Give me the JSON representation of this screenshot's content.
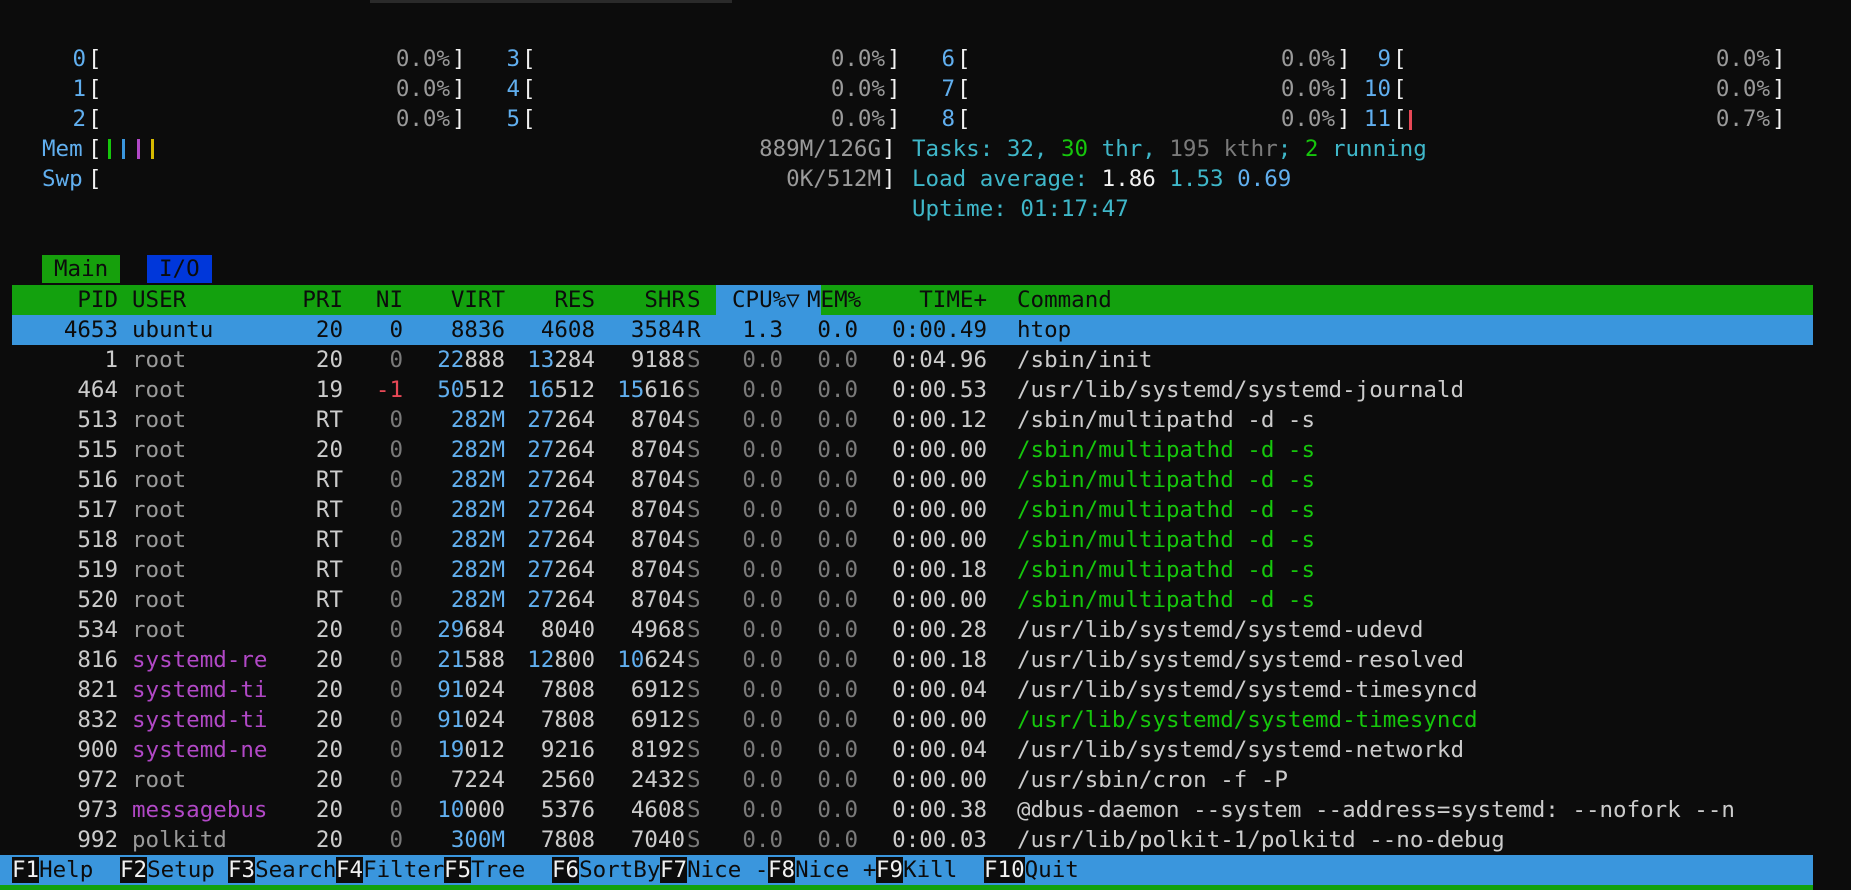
{
  "cpus": [
    {
      "id": "0",
      "pct": "0.0%"
    },
    {
      "id": "1",
      "pct": "0.0%"
    },
    {
      "id": "2",
      "pct": "0.0%"
    },
    {
      "id": "3",
      "pct": "0.0%"
    },
    {
      "id": "4",
      "pct": "0.0%"
    },
    {
      "id": "5",
      "pct": "0.0%"
    },
    {
      "id": "6",
      "pct": "0.0%"
    },
    {
      "id": "7",
      "pct": "0.0%"
    },
    {
      "id": "8",
      "pct": "0.0%"
    },
    {
      "id": "9",
      "pct": "0.0%"
    },
    {
      "id": "10",
      "pct": "0.0%"
    },
    {
      "id": "11",
      "pct": "0.7%"
    }
  ],
  "mem": {
    "label": "Mem",
    "value": "889M/126G"
  },
  "swp": {
    "label": "Swp",
    "value": "0K/512M"
  },
  "tasks": {
    "label": "Tasks: ",
    "count": "32",
    "sep": ", ",
    "thr": "30",
    "thr_label": " thr",
    "comma": ", ",
    "kthr": "195 kthr",
    "semi": "; ",
    "running": "2",
    "running_label": " running"
  },
  "load": {
    "label": "Load average: ",
    "l1": "1.86",
    "l5": "1.53",
    "l15": "0.69"
  },
  "uptime": {
    "label": "Uptime: ",
    "value": "01:17:47"
  },
  "tabs": {
    "main": "Main",
    "io": "I/O"
  },
  "columns": {
    "pid": "PID",
    "user": "USER",
    "pri": "PRI",
    "ni": "NI",
    "virt": "VIRT",
    "res": "RES",
    "shr": "SHR",
    "s": "S",
    "cpu": "CPU%▽",
    "mem": "MEM%",
    "time": "TIME+",
    "cmd": "Command"
  },
  "processes": [
    {
      "pid": "4653",
      "user": "ubuntu",
      "pri": "20",
      "ni": "0",
      "virt": "8836",
      "res": "4608",
      "shr": "3584",
      "s": "R",
      "cpu": "1.3",
      "mem": "0.0",
      "time": "0:00.49",
      "cmd": "htop",
      "selected": true
    },
    {
      "pid": "1",
      "user": "root",
      "pri": "20",
      "ni": "0",
      "virt": "22888",
      "res": "13284",
      "shr": "9188",
      "s": "S",
      "cpu": "0.0",
      "mem": "0.0",
      "time": "0:04.96",
      "cmd": "/sbin/init"
    },
    {
      "pid": "464",
      "user": "root",
      "pri": "19",
      "ni": "-1",
      "virt": "50512",
      "res": "16512",
      "shr": "15616",
      "s": "S",
      "cpu": "0.0",
      "mem": "0.0",
      "time": "0:00.53",
      "cmd": "/usr/lib/systemd/systemd-journald"
    },
    {
      "pid": "513",
      "user": "root",
      "pri": "RT",
      "ni": "0",
      "virt": "282M",
      "res": "27264",
      "shr": "8704",
      "s": "S",
      "cpu": "0.0",
      "mem": "0.0",
      "time": "0:00.12",
      "cmd": "/sbin/multipathd -d -s"
    },
    {
      "pid": "515",
      "user": "root",
      "pri": "20",
      "ni": "0",
      "virt": "282M",
      "res": "27264",
      "shr": "8704",
      "s": "S",
      "cpu": "0.0",
      "mem": "0.0",
      "time": "0:00.00",
      "cmd": "/sbin/multipathd -d -s",
      "thread": true
    },
    {
      "pid": "516",
      "user": "root",
      "pri": "RT",
      "ni": "0",
      "virt": "282M",
      "res": "27264",
      "shr": "8704",
      "s": "S",
      "cpu": "0.0",
      "mem": "0.0",
      "time": "0:00.00",
      "cmd": "/sbin/multipathd -d -s",
      "thread": true
    },
    {
      "pid": "517",
      "user": "root",
      "pri": "RT",
      "ni": "0",
      "virt": "282M",
      "res": "27264",
      "shr": "8704",
      "s": "S",
      "cpu": "0.0",
      "mem": "0.0",
      "time": "0:00.00",
      "cmd": "/sbin/multipathd -d -s",
      "thread": true
    },
    {
      "pid": "518",
      "user": "root",
      "pri": "RT",
      "ni": "0",
      "virt": "282M",
      "res": "27264",
      "shr": "8704",
      "s": "S",
      "cpu": "0.0",
      "mem": "0.0",
      "time": "0:00.00",
      "cmd": "/sbin/multipathd -d -s",
      "thread": true
    },
    {
      "pid": "519",
      "user": "root",
      "pri": "RT",
      "ni": "0",
      "virt": "282M",
      "res": "27264",
      "shr": "8704",
      "s": "S",
      "cpu": "0.0",
      "mem": "0.0",
      "time": "0:00.18",
      "cmd": "/sbin/multipathd -d -s",
      "thread": true
    },
    {
      "pid": "520",
      "user": "root",
      "pri": "RT",
      "ni": "0",
      "virt": "282M",
      "res": "27264",
      "shr": "8704",
      "s": "S",
      "cpu": "0.0",
      "mem": "0.0",
      "time": "0:00.00",
      "cmd": "/sbin/multipathd -d -s",
      "thread": true
    },
    {
      "pid": "534",
      "user": "root",
      "pri": "20",
      "ni": "0",
      "virt": "29684",
      "res": "8040",
      "shr": "4968",
      "s": "S",
      "cpu": "0.0",
      "mem": "0.0",
      "time": "0:00.28",
      "cmd": "/usr/lib/systemd/systemd-udevd"
    },
    {
      "pid": "816",
      "user": "systemd-re",
      "pri": "20",
      "ni": "0",
      "virt": "21588",
      "res": "12800",
      "shr": "10624",
      "s": "S",
      "cpu": "0.0",
      "mem": "0.0",
      "time": "0:00.18",
      "cmd": "/usr/lib/systemd/systemd-resolved",
      "userColor": "magenta"
    },
    {
      "pid": "821",
      "user": "systemd-ti",
      "pri": "20",
      "ni": "0",
      "virt": "91024",
      "res": "7808",
      "shr": "6912",
      "s": "S",
      "cpu": "0.0",
      "mem": "0.0",
      "time": "0:00.04",
      "cmd": "/usr/lib/systemd/systemd-timesyncd",
      "userColor": "magenta"
    },
    {
      "pid": "832",
      "user": "systemd-ti",
      "pri": "20",
      "ni": "0",
      "virt": "91024",
      "res": "7808",
      "shr": "6912",
      "s": "S",
      "cpu": "0.0",
      "mem": "0.0",
      "time": "0:00.00",
      "cmd": "/usr/lib/systemd/systemd-timesyncd",
      "userColor": "magenta",
      "thread": true
    },
    {
      "pid": "900",
      "user": "systemd-ne",
      "pri": "20",
      "ni": "0",
      "virt": "19012",
      "res": "9216",
      "shr": "8192",
      "s": "S",
      "cpu": "0.0",
      "mem": "0.0",
      "time": "0:00.04",
      "cmd": "/usr/lib/systemd/systemd-networkd",
      "userColor": "magenta"
    },
    {
      "pid": "972",
      "user": "root",
      "pri": "20",
      "ni": "0",
      "virt": "7224",
      "res": "2560",
      "shr": "2432",
      "s": "S",
      "cpu": "0.0",
      "mem": "0.0",
      "time": "0:00.00",
      "cmd": "/usr/sbin/cron -f -P"
    },
    {
      "pid": "973",
      "user": "messagebus",
      "pri": "20",
      "ni": "0",
      "virt": "10000",
      "res": "5376",
      "shr": "4608",
      "s": "S",
      "cpu": "0.0",
      "mem": "0.0",
      "time": "0:00.38",
      "cmd": "@dbus-daemon --system --address=systemd: --nofork --n",
      "userColor": "magenta"
    },
    {
      "pid": "992",
      "user": "polkitd",
      "pri": "20",
      "ni": "0",
      "virt": "300M",
      "res": "7808",
      "shr": "7040",
      "s": "S",
      "cpu": "0.0",
      "mem": "0.0",
      "time": "0:00.03",
      "cmd": "/usr/lib/polkit-1/polkitd --no-debug",
      "userColor": "gray"
    }
  ],
  "footer": [
    {
      "key": "F1",
      "label": "Help  "
    },
    {
      "key": "F2",
      "label": "Setup "
    },
    {
      "key": "F3",
      "label": "Search"
    },
    {
      "key": "F4",
      "label": "Filter"
    },
    {
      "key": "F5",
      "label": "Tree  "
    },
    {
      "key": "F6",
      "label": "SortBy"
    },
    {
      "key": "F7",
      "label": "Nice -"
    },
    {
      "key": "F8",
      "label": "Nice +"
    },
    {
      "key": "F9",
      "label": "Kill  "
    },
    {
      "key": "F10",
      "label": "Quit"
    }
  ],
  "colors": {
    "background": "#0c0c0c",
    "header": "#13a10e",
    "selected": "#3a96dd",
    "io_tab": "#0037da"
  }
}
